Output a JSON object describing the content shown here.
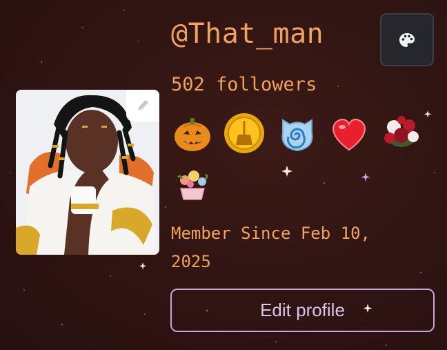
{
  "profile": {
    "username": "@That_man",
    "followers": "502 followers",
    "member_since": "Member Since Feb 10, 2025",
    "edit_profile_label": "Edit profile"
  },
  "badges": [
    {
      "icon": "jack-o-lantern-icon"
    },
    {
      "icon": "gold-coin-broom-icon"
    },
    {
      "icon": "blue-swirl-cat-icon"
    },
    {
      "icon": "sparkly-heart-icon"
    },
    {
      "icon": "roses-bouquet-icon"
    },
    {
      "icon": "flower-basket-icon"
    }
  ],
  "icons": {
    "theme_button": "palette-icon",
    "avatar_edit": "pencil-icon"
  },
  "colors": {
    "background": "#2f1412",
    "accent_text": "#f0a35e",
    "button_border": "#c7a6d6",
    "button_text": "#dcc3ea",
    "theme_button_bg": "#25272c"
  }
}
